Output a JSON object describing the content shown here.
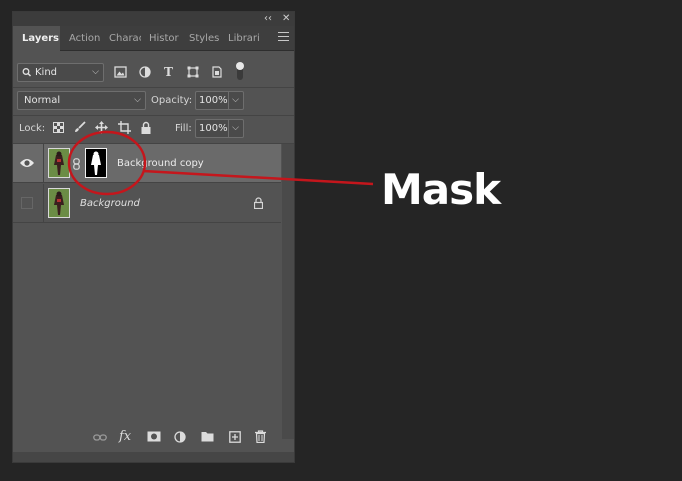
{
  "tabs": [
    {
      "label": "Layers",
      "active": true
    },
    {
      "label": "Action"
    },
    {
      "label": "Charac"
    },
    {
      "label": "Histor"
    },
    {
      "label": "Styles"
    },
    {
      "label": "Librari"
    }
  ],
  "window_controls": {
    "collapse": "‹‹",
    "close": "✕"
  },
  "filter": {
    "kind_label": "Kind"
  },
  "blend": {
    "mode": "Normal",
    "opacity_label": "Opacity:",
    "opacity_value": "100%"
  },
  "lock": {
    "label": "Lock:",
    "fill_label": "Fill:",
    "fill_value": "100%"
  },
  "layers": [
    {
      "name": "Background copy",
      "visible": true,
      "selected": true,
      "has_mask": true
    },
    {
      "name": "Background",
      "visible": false,
      "locked": true
    }
  ],
  "annotation": {
    "callout_text": "Mask",
    "color": "#c4161c"
  },
  "colors": {
    "panel_bg": "#535353",
    "canvas_bg": "#252525",
    "selected_row": "#6a6a6a"
  }
}
